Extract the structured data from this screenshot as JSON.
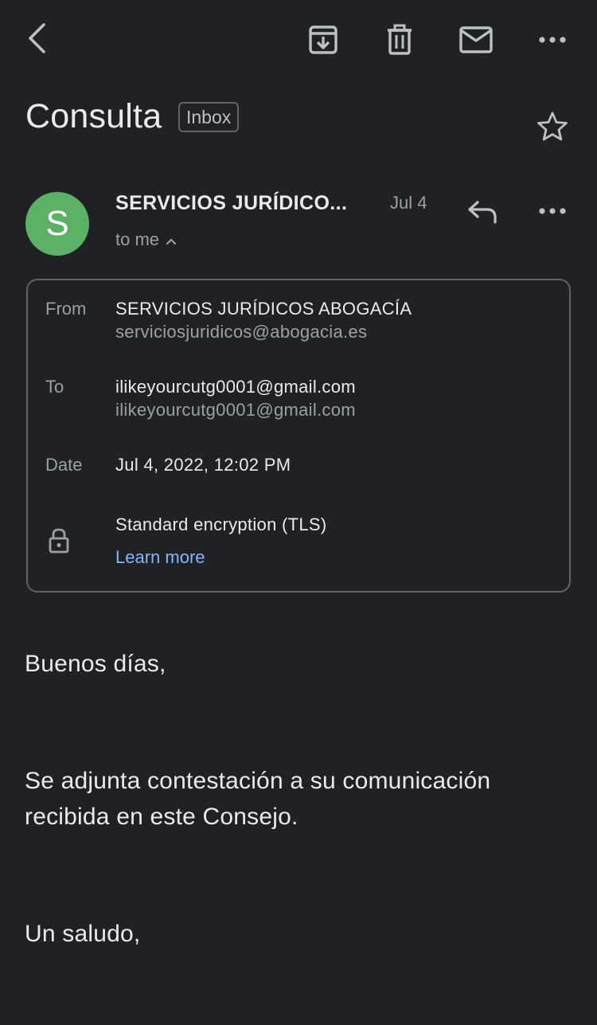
{
  "toolbar": {
    "icons": [
      "back-arrow-icon",
      "archive-icon",
      "delete-icon",
      "mark-unread-icon",
      "more-options-icon"
    ]
  },
  "email": {
    "subject": "Consulta",
    "label": "Inbox",
    "starred": false
  },
  "sender": {
    "avatar_letter": "S",
    "avatar_color": "#5bb264",
    "name": "SERVICIOS JURÍDICO...",
    "date": "Jul 4",
    "recipient_summary": "to me"
  },
  "details": {
    "from_label": "From",
    "from_name": "SERVICIOS JURÍDICOS ABOGACÍA",
    "from_email": "serviciosjuridicos@abogacia.es",
    "to_label": "To",
    "to_name": "ilikeyourcutg0001@gmail.com",
    "to_email": "ilikeyourcutg0001@gmail.com",
    "date_label": "Date",
    "date_value": "Jul 4, 2022, 12:02 PM",
    "encryption": "Standard encryption (TLS)",
    "learn_more": "Learn more"
  },
  "body": {
    "greeting": "Buenos días,",
    "paragraph": "Se adjunta contestación a su comunicación recibida en este Consejo.",
    "closing": "Un saludo,"
  },
  "colors": {
    "background": "#202124",
    "text": "#e8eaed",
    "muted": "#9aa0a6",
    "link": "#8ab4f8",
    "border": "#5f6368"
  }
}
